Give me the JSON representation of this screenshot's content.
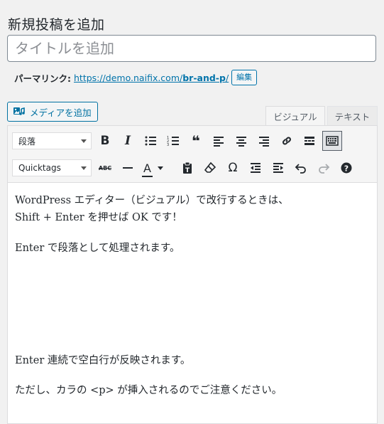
{
  "page": {
    "title": "新規投稿を追加"
  },
  "title_field": {
    "placeholder": "タイトルを追加",
    "value": ""
  },
  "permalink": {
    "label": "パーマリンク:",
    "url_prefix": "https://demo.naifix.com/",
    "url_slug": "br-and-p",
    "url_suffix": "/",
    "edit_label": "編集"
  },
  "media_button": {
    "label": "メディアを追加",
    "icon": "add-media-icon"
  },
  "editor_tabs": [
    {
      "label": "ビジュアル",
      "active": true
    },
    {
      "label": "テキスト",
      "active": false
    }
  ],
  "toolbar": {
    "format_select": "段落",
    "quicktags_select": "Quicktags",
    "row1_icons": [
      "bold-icon",
      "italic-icon",
      "bulleted-list-icon",
      "numbered-list-icon",
      "blockquote-icon",
      "align-left-icon",
      "align-center-icon",
      "align-right-icon",
      "link-icon",
      "read-more-icon",
      "toolbar-toggle-icon"
    ],
    "row2_icons": [
      "strikethrough-icon",
      "horizontal-line-icon",
      "text-color-icon",
      "paste-as-text-icon",
      "clear-formatting-icon",
      "special-character-icon",
      "outdent-icon",
      "indent-icon",
      "undo-icon",
      "redo-icon",
      "help-icon"
    ],
    "bold_glyph": "B",
    "italic_glyph": "I",
    "quote_glyph": "❝",
    "omega_glyph": "Ω",
    "strike_glyph": "ABC",
    "text_color_glyph": "A"
  },
  "content": {
    "line1": "WordPress エディター（ビジュアル）で改行するときは、",
    "line2": "Shift + Enter を押せば OK です！",
    "line3": "Enter で段落として処理されます。",
    "line4": "Enter 連続で空白行が反映されます。",
    "line5": "ただし、カラの <p> が挿入されるのでご注意ください。"
  },
  "colors": {
    "link": "#0073aa",
    "border": "#dcdcde",
    "background": "#f1f1f1"
  }
}
